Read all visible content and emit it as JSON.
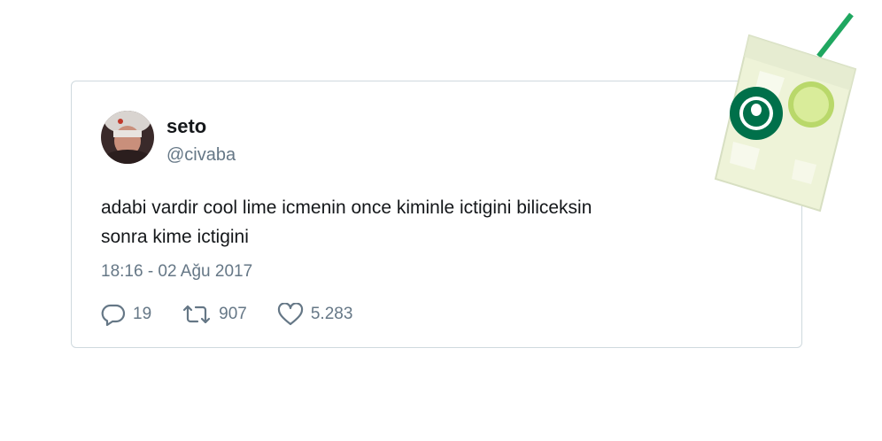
{
  "tweet": {
    "name": "seto",
    "handle": "@civaba",
    "text_line1": "adabi vardir cool lime icmenin once kiminle ictigini biliceksin",
    "text_line2": "sonra kime ictigini",
    "timestamp": "18:16 - 02 Ağu 2017",
    "replies": "19",
    "retweets": "907",
    "likes": "5.283"
  },
  "icons": {
    "reply": "reply-icon",
    "retweet": "retweet-icon",
    "like": "heart-icon"
  },
  "colors": {
    "text": "#14171a",
    "muted": "#657786",
    "border": "#cfd9de",
    "straw": "#1fa760",
    "logo": "#00704a"
  }
}
